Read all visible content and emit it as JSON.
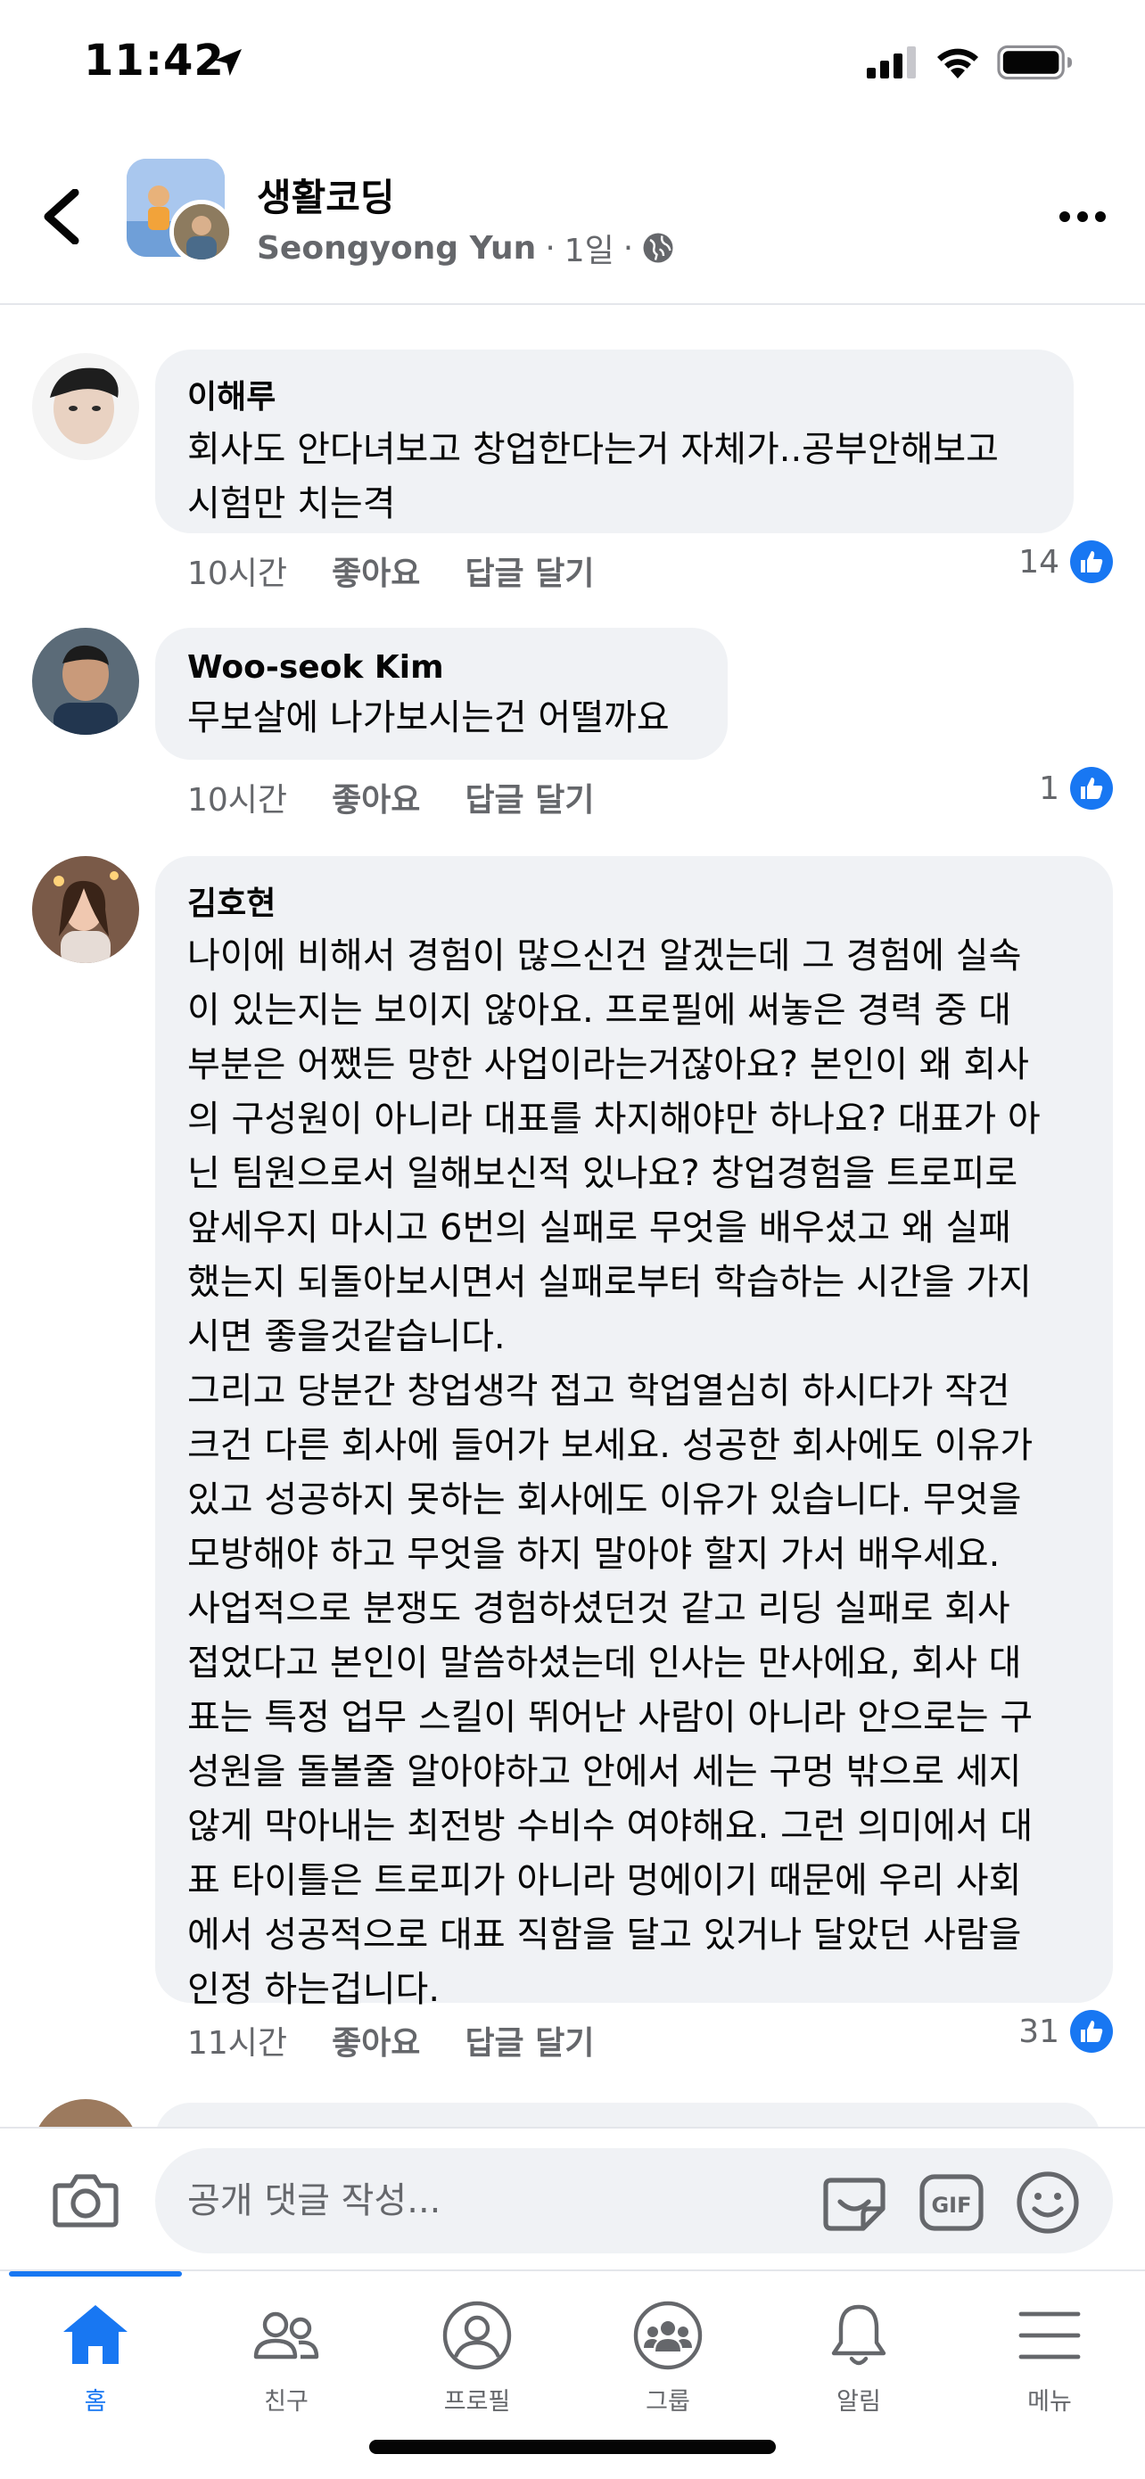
{
  "status_bar": {
    "time": "11:42"
  },
  "header": {
    "group_name": "생활코딩",
    "author": "Seongyong Yun",
    "dot1": "·",
    "time_ago": "1일",
    "dot2": "·"
  },
  "comments": [
    {
      "author": "이해루",
      "text": "회사도 안다녀보고 창업한다는거 자체가..공부안해보고\n시험만 치는격",
      "time_ago": "10시간",
      "like_label": "좋아요",
      "reply_label": "답글 달기",
      "reaction_count": "14"
    },
    {
      "author": "Woo-seok Kim",
      "text": "무보살에 나가보시는건 어떨까요",
      "time_ago": "10시간",
      "like_label": "좋아요",
      "reply_label": "답글 달기",
      "reaction_count": "1"
    },
    {
      "author": "김호현",
      "text": "나이에 비해서 경험이 많으신건 알겠는데 그 경험에 실속\n이 있는지는 보이지 않아요. 프로필에 써놓은 경력 중 대\n부분은 어쨌든 망한 사업이라는거잖아요? 본인이 왜 회사\n의 구성원이 아니라 대표를 차지해야만 하나요? 대표가 아\n닌 팀원으로서 일해보신적 있나요? 창업경험을 트로피로\n앞세우지 마시고 6번의 실패로 무엇을 배우셨고 왜 실패\n했는지 되돌아보시면서 실패로부터 학습하는 시간을 가지\n시면 좋을것같습니다.\n그리고 당분간 창업생각 접고 학업열심히 하시다가 작건\n크건 다른 회사에 들어가 보세요. 성공한 회사에도 이유가\n있고 성공하지 못하는 회사에도 이유가 있습니다. 무엇을\n모방해야 하고 무엇을 하지 말아야 할지 가서 배우세요.\n사업적으로 분쟁도 경험하셨던것 같고 리딩 실패로 회사\n접었다고 본인이 말씀하셨는데 인사는 만사에요, 회사 대\n표는 특정 업무 스킬이 뛰어난 사람이 아니라 안으로는 구\n성원을 돌볼줄 알아야하고 안에서 세는 구멍 밖으로 세지\n않게 막아내는 최전방 수비수 여야해요. 그런 의미에서 대\n표 타이틀은 트로피가 아니라 멍에이기 때문에 우리 사회\n에서 성공적으로 대표 직함을 달고 있거나 달았던 사람을\n인정 하는겁니다.",
      "time_ago": "11시간",
      "like_label": "좋아요",
      "reply_label": "답글 달기",
      "reaction_count": "31"
    }
  ],
  "composer": {
    "placeholder": "공개 댓글 작성..."
  },
  "tabs": [
    {
      "label": "홈",
      "icon": "home-icon",
      "active": true
    },
    {
      "label": "친구",
      "icon": "friends-icon"
    },
    {
      "label": "프로필",
      "icon": "profile-icon"
    },
    {
      "label": "그룹",
      "icon": "groups-icon"
    },
    {
      "label": "알림",
      "icon": "bell-icon"
    },
    {
      "label": "메뉴",
      "icon": "menu-icon"
    }
  ],
  "colors": {
    "accent": "#1877f2",
    "bubble": "#f0f2f5",
    "secondary_text": "#65676b"
  }
}
